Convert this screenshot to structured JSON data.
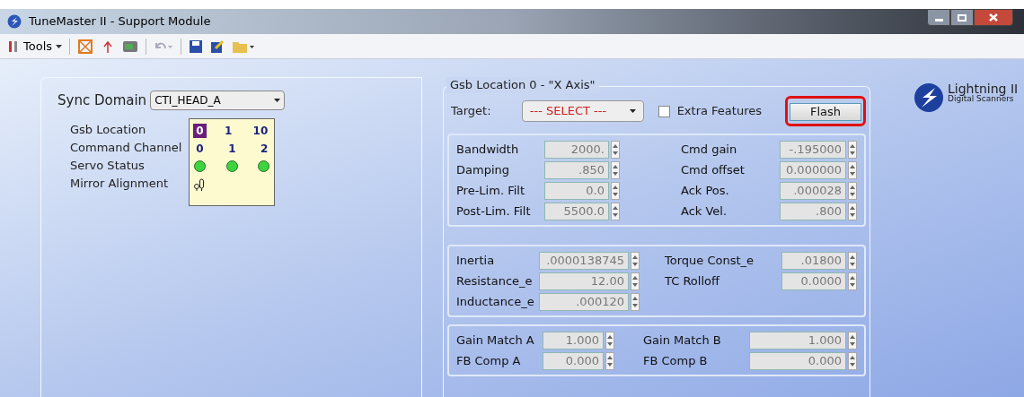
{
  "window": {
    "title": "TuneMaster II - Support Module"
  },
  "toolbar": {
    "tools_label": "Tools"
  },
  "sync_domain": {
    "label": "Sync Domain",
    "value": "CTI_HEAD_A"
  },
  "status_grid": {
    "row_labels": [
      "Gsb Location",
      "Command Channel",
      "Servo Status",
      "Mirror Alignment"
    ],
    "gsb_locations": [
      {
        "label": "0",
        "selected": true
      },
      {
        "label": "1",
        "selected": false
      },
      {
        "label": "10",
        "selected": false
      }
    ],
    "command_channels": [
      "0",
      "1",
      "2"
    ],
    "servo_status": [
      {
        "on": true
      },
      {
        "on": true
      },
      {
        "on": true
      }
    ]
  },
  "group": {
    "title": "Gsb Location 0 - \"X Axis\"",
    "target_label": "Target:",
    "target_value": "--- SELECT ---",
    "extra_features": {
      "label": "Extra Features",
      "checked": false
    },
    "flash": {
      "label": "Flash",
      "highlighted": true
    }
  },
  "servo_params": {
    "left": [
      {
        "label": "Bandwidth",
        "value": "2000."
      },
      {
        "label": "Damping",
        "value": ".850"
      },
      {
        "label": "Pre-Lim. Filt",
        "value": "0.0"
      },
      {
        "label": "Post-Lim. Filt",
        "value": "5500.0"
      }
    ],
    "right": [
      {
        "label": "Cmd gain",
        "value": "-.195000"
      },
      {
        "label": "Cmd offset",
        "value": "0.000000"
      },
      {
        "label": "Ack Pos.",
        "value": ".000028"
      },
      {
        "label": "Ack Vel.",
        "value": ".800"
      }
    ]
  },
  "motor_params": {
    "left": [
      {
        "label": "Inertia",
        "value": ".0000138745"
      },
      {
        "label": "Resistance_e",
        "value": "12.00"
      },
      {
        "label": "Inductance_e",
        "value": ".000120"
      }
    ],
    "right": [
      {
        "label": "Torque Const_e",
        "value": ".01800"
      },
      {
        "label": "TC Rolloff",
        "value": "0.0000"
      }
    ]
  },
  "match_params": {
    "left": [
      {
        "label": "Gain Match A",
        "value": "1.000"
      },
      {
        "label": "FB Comp A",
        "value": "0.000"
      }
    ],
    "right": [
      {
        "label": "Gain Match B",
        "value": "1.000"
      },
      {
        "label": "FB Comp B",
        "value": "0.000"
      }
    ]
  },
  "logo": {
    "name": "Lightning II",
    "subtitle": "Digital Scanners"
  }
}
